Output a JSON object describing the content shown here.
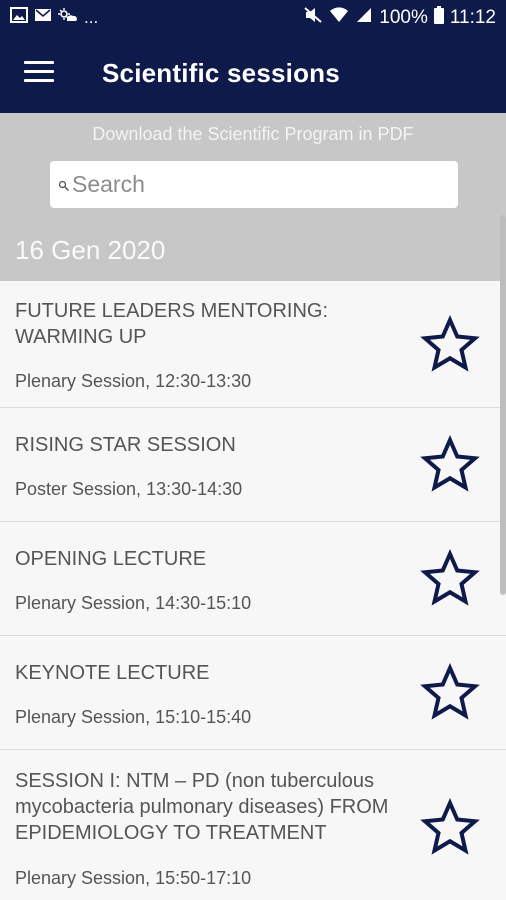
{
  "status_bar": {
    "battery": "100%",
    "time": "11:12",
    "overflow": "..."
  },
  "app_bar": {
    "title": "Scientific sessions"
  },
  "header": {
    "pdf_link": "Download the Scientific Program in PDF",
    "search_placeholder": "Search",
    "date": "16 Gen 2020"
  },
  "sessions": [
    {
      "title": "FUTURE LEADERS MENTORING: WARMING UP",
      "subtitle": "Plenary Session, 12:30-13:30"
    },
    {
      "title": "RISING STAR SESSION",
      "subtitle": "Poster Session, 13:30-14:30"
    },
    {
      "title": "OPENING LECTURE",
      "subtitle": "Plenary Session, 14:30-15:10"
    },
    {
      "title": "KEYNOTE LECTURE",
      "subtitle": "Plenary Session, 15:10-15:40"
    },
    {
      "title": "SESSION I: NTM – PD (non tuberculous mycobacteria pulmonary diseases) FROM EPIDEMIOLOGY TO TREATMENT",
      "subtitle": "Plenary Session, 15:50-17:10"
    }
  ],
  "colors": {
    "app_bar": "#0d1a4a",
    "header_bg": "#c7c7c7",
    "star_outline": "#0d1a4a"
  },
  "icons": {
    "menu": "hamburger-menu-icon",
    "search": "magnifier-icon",
    "favorite": "star-outline-icon"
  }
}
